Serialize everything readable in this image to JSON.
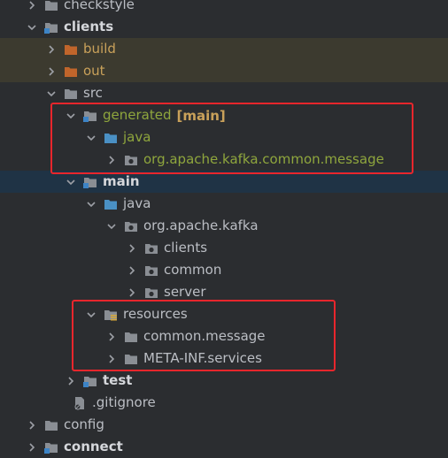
{
  "tree": {
    "checkstyle": "checkstyle",
    "clients": "clients",
    "build": "build",
    "out": "out",
    "src": "src",
    "generated": "generated",
    "generated_tag": "[main]",
    "gen_java": "java",
    "gen_pkg": "org.apache.kafka.common.message",
    "main": "main",
    "main_java": "java",
    "main_pkg": "org.apache.kafka",
    "pkg_clients": "clients",
    "pkg_common": "common",
    "pkg_server": "server",
    "resources": "resources",
    "res_common_message": "common.message",
    "res_meta_inf": "META-INF.services",
    "test": "test",
    "gitignore": ".gitignore",
    "config": "config",
    "connect": "connect"
  },
  "colors": {
    "highlight_box": "#e8262c",
    "excluded_folder": "#c0652b",
    "source_folder": "#4a90c4",
    "generated_label": "#8fa63d",
    "module_tag": "#c9a15a"
  }
}
